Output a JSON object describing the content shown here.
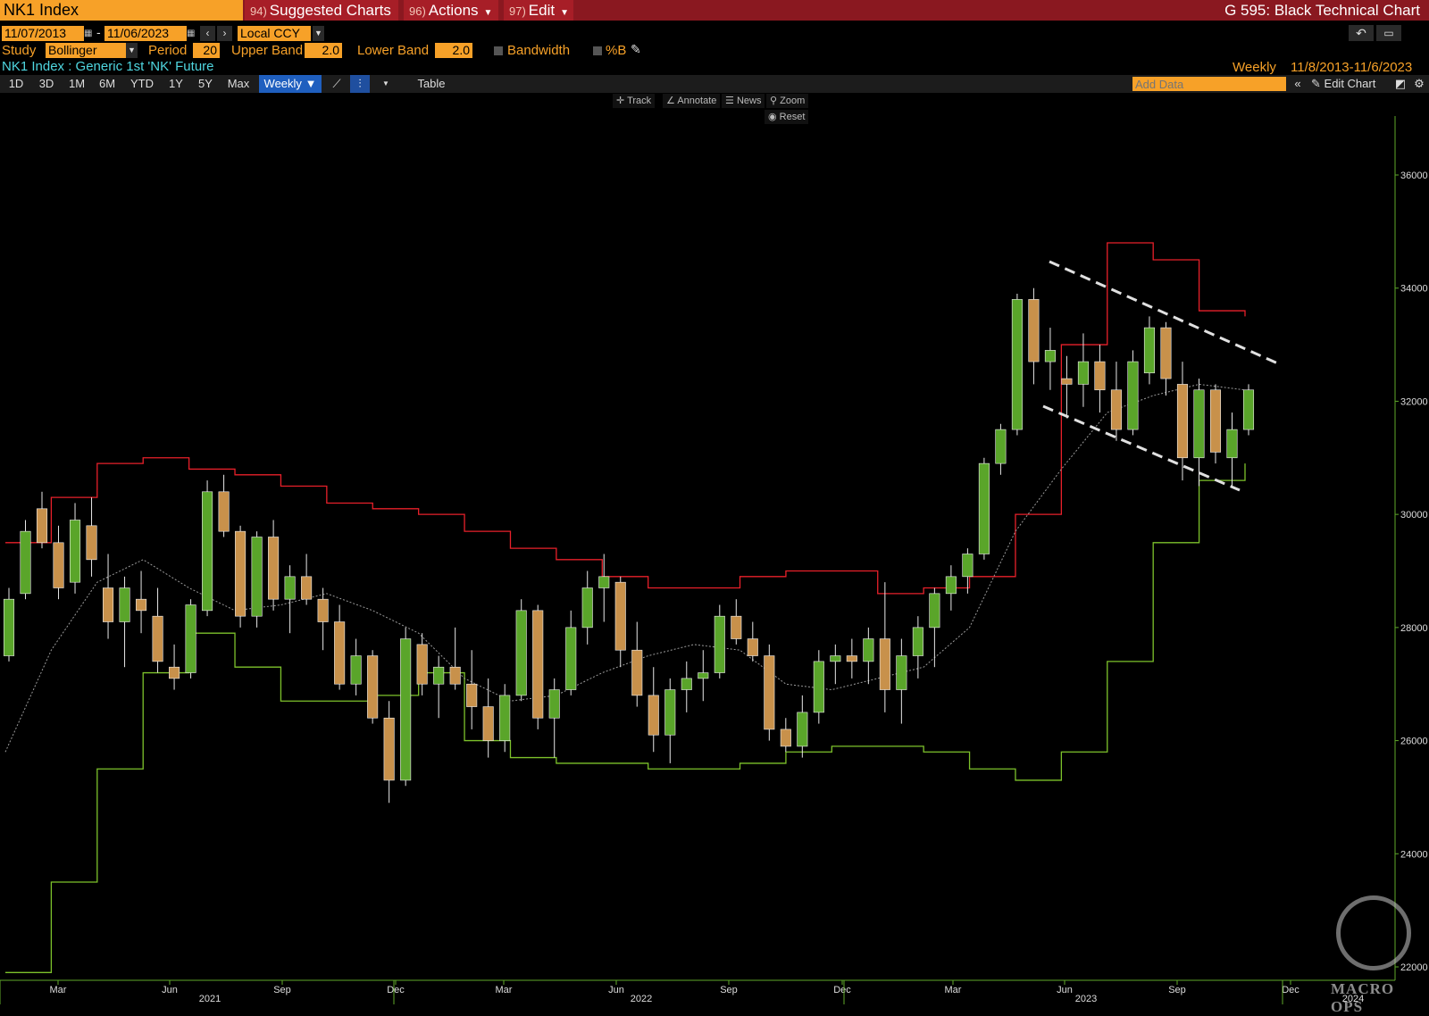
{
  "header": {
    "ticker": "NK1 Index",
    "menus": [
      {
        "num": "94)",
        "label": "Suggested Charts"
      },
      {
        "num": "96)",
        "label": "Actions"
      },
      {
        "num": "97)",
        "label": "Edit"
      }
    ],
    "chart_title": "G 595: Black Technical Chart"
  },
  "range": {
    "start": "11/07/2013",
    "dash": "-",
    "end": "11/06/2023",
    "currency": "Local CCY"
  },
  "study": {
    "study_label": "Study",
    "study_value": "Bollinger",
    "period_label": "Period",
    "period_value": "20",
    "upper_label": "Upper Band",
    "upper_value": "2.0",
    "lower_label": "Lower Band",
    "lower_value": "2.0",
    "bandwidth_label": "Bandwidth",
    "pctb_label": "%B"
  },
  "security": {
    "description": "NK1 Index : Generic 1st 'NK' Future",
    "frequency": "Weekly",
    "date_range": "11/8/2013-11/6/2023"
  },
  "toolbar": {
    "periods": [
      "1D",
      "3D",
      "1M",
      "6M",
      "YTD",
      "1Y",
      "5Y",
      "Max"
    ],
    "frequency_select": "Weekly",
    "table_label": "Table",
    "add_data_placeholder": "Add Data",
    "edit_chart_label": "Edit Chart"
  },
  "chart_tools": {
    "track": "Track",
    "annotate": "Annotate",
    "news": "News",
    "zoom": "Zoom",
    "reset": "Reset"
  },
  "watermark": "MACRO OPS",
  "colors": {
    "orange": "#f7a128",
    "header_red": "#8a1820",
    "upper_band": "#e8202a",
    "lower_band": "#7dc22b",
    "up_candle": "#5aa52a",
    "down_candle": "#c8914b"
  },
  "chart_data": {
    "type": "candlestick",
    "y_axis_ticks": [
      22000,
      24000,
      26000,
      28000,
      30000,
      32000,
      34000,
      36000
    ],
    "ylim": [
      21900,
      36900
    ],
    "x_month_labels": [
      "Mar",
      "Jun",
      "Sep",
      "Dec",
      "Mar",
      "Jun",
      "Sep",
      "Dec",
      "Mar",
      "Jun",
      "Sep",
      "Dec"
    ],
    "x_year_labels": [
      "2021",
      "2022",
      "2023",
      "2024"
    ],
    "grid": false,
    "series": [
      {
        "name": "Upper Band",
        "values": [
          29500,
          30300,
          30900,
          31000,
          30800,
          30700,
          30500,
          30200,
          30100,
          30000,
          29700,
          29400,
          29200,
          28900,
          28700,
          28700,
          28900,
          29000,
          29000,
          28600,
          28700,
          28900,
          30000,
          33000,
          34800,
          34500,
          33600,
          33500
        ]
      },
      {
        "name": "Lower Band",
        "values": [
          21900,
          23500,
          25500,
          27200,
          27900,
          27300,
          26700,
          26700,
          26800,
          27200,
          26000,
          25700,
          25600,
          25600,
          25500,
          25500,
          25600,
          25800,
          25900,
          25900,
          25800,
          25500,
          25300,
          25800,
          27400,
          29500,
          30600,
          30900
        ]
      },
      {
        "name": "Moving Average",
        "values": [
          25800,
          27600,
          28800,
          29200,
          28700,
          28300,
          28400,
          28600,
          28300,
          27900,
          27100,
          26700,
          26800,
          27200,
          27500,
          27700,
          27600,
          27000,
          26900,
          27100,
          27300,
          28000,
          29700,
          30800,
          31800,
          32100,
          32300,
          32200
        ]
      }
    ],
    "ohlc": [
      {
        "o": 27500,
        "h": 28700,
        "l": 27400,
        "c": 28500
      },
      {
        "o": 28600,
        "h": 29900,
        "l": 28500,
        "c": 29700
      },
      {
        "o": 30100,
        "h": 30400,
        "l": 29400,
        "c": 29500
      },
      {
        "o": 29500,
        "h": 29800,
        "l": 28500,
        "c": 28700
      },
      {
        "o": 28800,
        "h": 30200,
        "l": 28600,
        "c": 29900
      },
      {
        "o": 29800,
        "h": 30300,
        "l": 28900,
        "c": 29200
      },
      {
        "o": 28700,
        "h": 29300,
        "l": 27800,
        "c": 28100
      },
      {
        "o": 28100,
        "h": 28900,
        "l": 27300,
        "c": 28700
      },
      {
        "o": 28500,
        "h": 29000,
        "l": 27900,
        "c": 28300
      },
      {
        "o": 28200,
        "h": 28700,
        "l": 27200,
        "c": 27400
      },
      {
        "o": 27300,
        "h": 27700,
        "l": 26900,
        "c": 27100
      },
      {
        "o": 27200,
        "h": 28500,
        "l": 27100,
        "c": 28400
      },
      {
        "o": 28300,
        "h": 30600,
        "l": 28200,
        "c": 30400
      },
      {
        "o": 30400,
        "h": 30700,
        "l": 29600,
        "c": 29700
      },
      {
        "o": 29700,
        "h": 29800,
        "l": 28000,
        "c": 28200
      },
      {
        "o": 28200,
        "h": 29700,
        "l": 28000,
        "c": 29600
      },
      {
        "o": 29600,
        "h": 29900,
        "l": 28300,
        "c": 28500
      },
      {
        "o": 28500,
        "h": 29100,
        "l": 27900,
        "c": 28900
      },
      {
        "o": 28900,
        "h": 29300,
        "l": 28400,
        "c": 28500
      },
      {
        "o": 28500,
        "h": 28700,
        "l": 27600,
        "c": 28100
      },
      {
        "o": 28100,
        "h": 28400,
        "l": 26900,
        "c": 27000
      },
      {
        "o": 27000,
        "h": 27800,
        "l": 26800,
        "c": 27500
      },
      {
        "o": 27500,
        "h": 27600,
        "l": 26300,
        "c": 26400
      },
      {
        "o": 26400,
        "h": 26700,
        "l": 24900,
        "c": 25300
      },
      {
        "o": 25300,
        "h": 28000,
        "l": 25200,
        "c": 27800
      },
      {
        "o": 27700,
        "h": 27900,
        "l": 26800,
        "c": 27000
      },
      {
        "o": 27000,
        "h": 27500,
        "l": 26400,
        "c": 27300
      },
      {
        "o": 27300,
        "h": 28000,
        "l": 26900,
        "c": 27000
      },
      {
        "o": 27000,
        "h": 27600,
        "l": 26200,
        "c": 26600
      },
      {
        "o": 26600,
        "h": 27100,
        "l": 25700,
        "c": 26000
      },
      {
        "o": 26000,
        "h": 27000,
        "l": 25800,
        "c": 26800
      },
      {
        "o": 26800,
        "h": 28500,
        "l": 26700,
        "c": 28300
      },
      {
        "o": 28300,
        "h": 28400,
        "l": 26200,
        "c": 26400
      },
      {
        "o": 26400,
        "h": 27100,
        "l": 25700,
        "c": 26900
      },
      {
        "o": 26900,
        "h": 28300,
        "l": 26800,
        "c": 28000
      },
      {
        "o": 28000,
        "h": 29000,
        "l": 27700,
        "c": 28700
      },
      {
        "o": 28700,
        "h": 29300,
        "l": 28100,
        "c": 28900
      },
      {
        "o": 28800,
        "h": 28900,
        "l": 27300,
        "c": 27600
      },
      {
        "o": 27600,
        "h": 28100,
        "l": 26600,
        "c": 26800
      },
      {
        "o": 26800,
        "h": 27300,
        "l": 25800,
        "c": 26100
      },
      {
        "o": 26100,
        "h": 27100,
        "l": 25600,
        "c": 26900
      },
      {
        "o": 26900,
        "h": 27400,
        "l": 26500,
        "c": 27100
      },
      {
        "o": 27100,
        "h": 27600,
        "l": 26700,
        "c": 27200
      },
      {
        "o": 27200,
        "h": 28400,
        "l": 27100,
        "c": 28200
      },
      {
        "o": 28200,
        "h": 28500,
        "l": 27700,
        "c": 27800
      },
      {
        "o": 27800,
        "h": 28100,
        "l": 27400,
        "c": 27500
      },
      {
        "o": 27500,
        "h": 27700,
        "l": 26000,
        "c": 26200
      },
      {
        "o": 26200,
        "h": 26400,
        "l": 25800,
        "c": 25900
      },
      {
        "o": 25900,
        "h": 26800,
        "l": 25700,
        "c": 26500
      },
      {
        "o": 26500,
        "h": 27600,
        "l": 26300,
        "c": 27400
      },
      {
        "o": 27400,
        "h": 27700,
        "l": 27000,
        "c": 27500
      },
      {
        "o": 27500,
        "h": 27800,
        "l": 27100,
        "c": 27400
      },
      {
        "o": 27400,
        "h": 28000,
        "l": 27000,
        "c": 27800
      },
      {
        "o": 27800,
        "h": 28800,
        "l": 26500,
        "c": 26900
      },
      {
        "o": 26900,
        "h": 27800,
        "l": 26300,
        "c": 27500
      },
      {
        "o": 27500,
        "h": 28200,
        "l": 27100,
        "c": 28000
      },
      {
        "o": 28000,
        "h": 28700,
        "l": 27300,
        "c": 28600
      },
      {
        "o": 28600,
        "h": 29100,
        "l": 28300,
        "c": 28900
      },
      {
        "o": 28900,
        "h": 29400,
        "l": 28600,
        "c": 29300
      },
      {
        "o": 29300,
        "h": 31000,
        "l": 29200,
        "c": 30900
      },
      {
        "o": 30900,
        "h": 31600,
        "l": 30700,
        "c": 31500
      },
      {
        "o": 31500,
        "h": 33900,
        "l": 31400,
        "c": 33800
      },
      {
        "o": 33800,
        "h": 34000,
        "l": 32300,
        "c": 32700
      },
      {
        "o": 32700,
        "h": 33300,
        "l": 32200,
        "c": 32900
      },
      {
        "o": 32400,
        "h": 32800,
        "l": 31700,
        "c": 32300
      },
      {
        "o": 32300,
        "h": 33200,
        "l": 31900,
        "c": 32700
      },
      {
        "o": 32700,
        "h": 33000,
        "l": 31800,
        "c": 32200
      },
      {
        "o": 32200,
        "h": 32700,
        "l": 31300,
        "c": 31500
      },
      {
        "o": 31500,
        "h": 32900,
        "l": 31400,
        "c": 32700
      },
      {
        "o": 32500,
        "h": 33500,
        "l": 32300,
        "c": 33300
      },
      {
        "o": 33300,
        "h": 33400,
        "l": 32100,
        "c": 32400
      },
      {
        "o": 32300,
        "h": 32700,
        "l": 30600,
        "c": 31000
      },
      {
        "o": 31000,
        "h": 32400,
        "l": 30500,
        "c": 32200
      },
      {
        "o": 32200,
        "h": 32300,
        "l": 30900,
        "c": 31100
      },
      {
        "o": 31000,
        "h": 31800,
        "l": 30500,
        "c": 31500
      },
      {
        "o": 31500,
        "h": 32300,
        "l": 31400,
        "c": 32200
      }
    ],
    "trendlines": [
      {
        "from": {
          "x": 1175,
          "y": 293
        },
        "to": {
          "x": 1435,
          "y": 409
        }
      },
      {
        "from": {
          "x": 1168,
          "y": 455
        },
        "to": {
          "x": 1388,
          "y": 549
        }
      }
    ]
  }
}
